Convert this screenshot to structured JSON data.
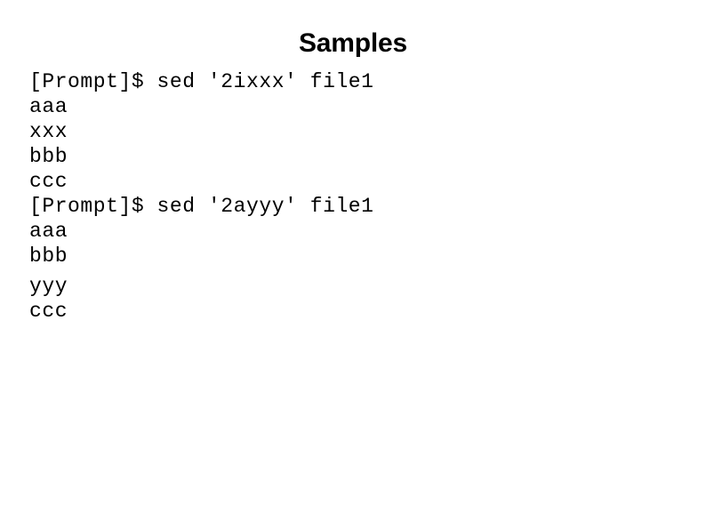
{
  "slide": {
    "title": "Samples",
    "background_color": "#ffffff",
    "text_color": "#000000"
  },
  "terminal": {
    "lines": [
      {
        "text": "[Prompt]$ sed '2ixxx' file1",
        "kind": "command",
        "gap_before": false
      },
      {
        "text": "aaa",
        "kind": "output",
        "gap_before": false
      },
      {
        "text": "xxx",
        "kind": "output",
        "gap_before": false
      },
      {
        "text": "bbb",
        "kind": "output",
        "gap_before": false
      },
      {
        "text": "ccc",
        "kind": "output",
        "gap_before": false
      },
      {
        "text": "[Prompt]$ sed '2ayyy' file1",
        "kind": "command",
        "gap_before": false
      },
      {
        "text": "aaa",
        "kind": "output",
        "gap_before": false
      },
      {
        "text": "bbb",
        "kind": "output",
        "gap_before": false
      },
      {
        "text": "yyy",
        "kind": "output",
        "gap_before": true
      },
      {
        "text": "ccc",
        "kind": "output",
        "gap_before": false
      }
    ]
  }
}
